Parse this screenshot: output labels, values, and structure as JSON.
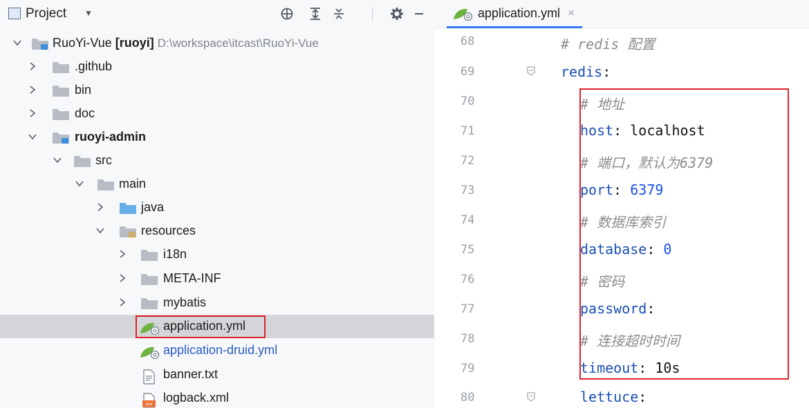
{
  "project_panel": {
    "title": "Project",
    "tree": [
      {
        "name": "RuoYi-Vue",
        "module": "[ruoyi]",
        "path": "D:\\workspace\\itcast\\RuoYi-Vue"
      },
      {
        "name": ".github"
      },
      {
        "name": "bin"
      },
      {
        "name": "doc"
      },
      {
        "name": "ruoyi-admin"
      },
      {
        "name": "src"
      },
      {
        "name": "main"
      },
      {
        "name": "java"
      },
      {
        "name": "resources"
      },
      {
        "name": "i18n"
      },
      {
        "name": "META-INF"
      },
      {
        "name": "mybatis"
      },
      {
        "name": "application.yml"
      },
      {
        "name": "application-druid.yml"
      },
      {
        "name": "banner.txt"
      },
      {
        "name": "logback.xml"
      }
    ]
  },
  "editor": {
    "tab_label": "application.yml",
    "lines": [
      {
        "no": "68",
        "text": "# redis 配置"
      },
      {
        "no": "69",
        "key": "redis",
        "colon": ":"
      },
      {
        "no": "70",
        "text": "# 地址"
      },
      {
        "no": "71",
        "key": "host",
        "colon": ": ",
        "value": "localhost"
      },
      {
        "no": "72",
        "text": "# 端口，默认为6379"
      },
      {
        "no": "73",
        "key": "port",
        "colon": ": ",
        "value": "6379"
      },
      {
        "no": "74",
        "text": "# 数据库索引"
      },
      {
        "no": "75",
        "key": "database",
        "colon": ": ",
        "value": "0"
      },
      {
        "no": "76",
        "text": "# 密码"
      },
      {
        "no": "77",
        "key": "password",
        "colon": ":"
      },
      {
        "no": "78",
        "text": "# 连接超时时间"
      },
      {
        "no": "79",
        "key": "timeout",
        "colon": ": ",
        "value": "10s"
      },
      {
        "no": "80",
        "key": "lettuce",
        "colon": ":"
      }
    ]
  },
  "colors": {
    "highlight_border": "#e0222b",
    "selection": "#d4d5d8",
    "accent": "#3574f0"
  }
}
